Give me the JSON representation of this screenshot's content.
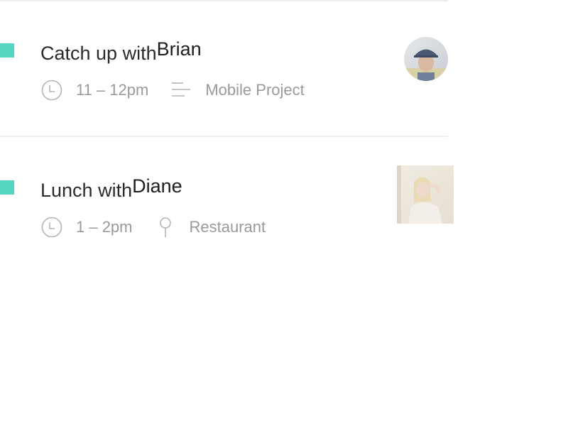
{
  "theme": {
    "accent": "#55d6c2",
    "divider": "#ececec",
    "title_color": "#2b2b2b",
    "meta_color": "#9a9a9a"
  },
  "events": [
    {
      "title_prefix": "Catch up with",
      "person": "Brian",
      "time": "11 – 12pm",
      "detail_icon": "notes-lines-icon",
      "detail": "Mobile Project",
      "avatar_icon": "avatar-brian-photo"
    },
    {
      "title_prefix": "Lunch with",
      "person": "Diane",
      "time": "1 – 2pm",
      "detail_icon": "map-pin-icon",
      "detail": "Restaurant",
      "avatar_icon": "avatar-diane-photo"
    }
  ]
}
